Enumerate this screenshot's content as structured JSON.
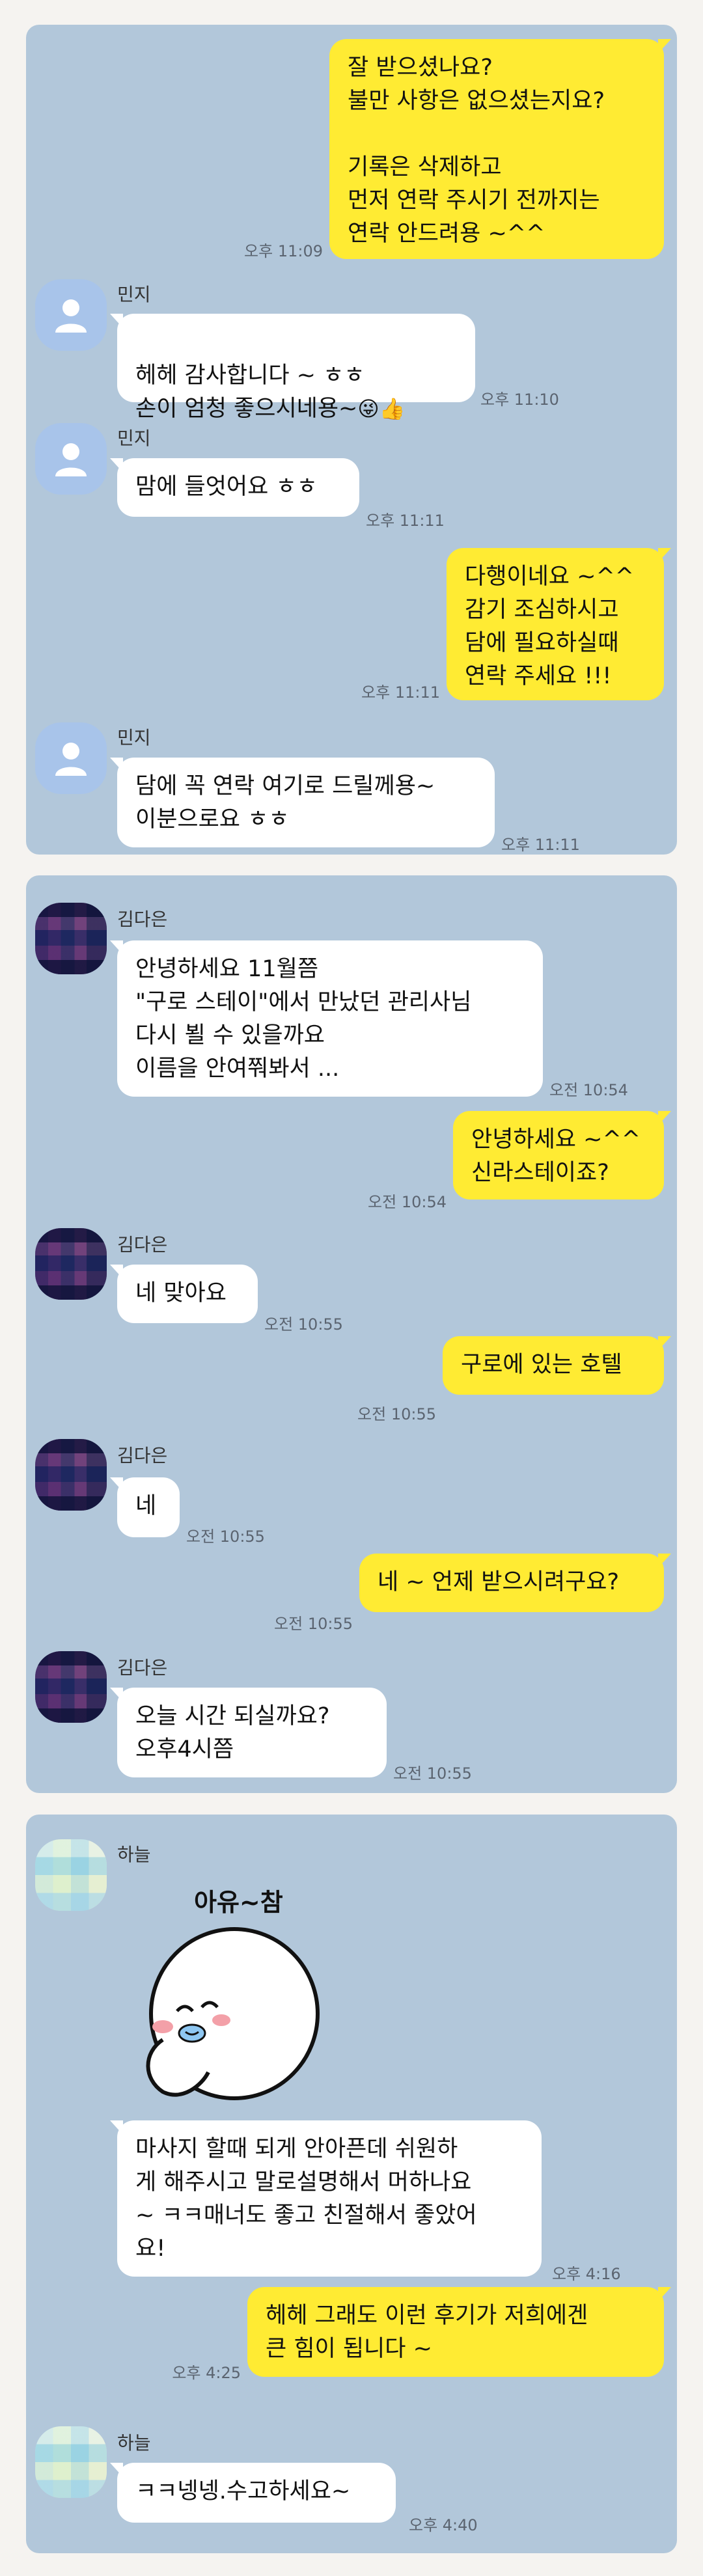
{
  "panel1": {
    "m1": {
      "text": "잘 받으셨나요?\n불만 사항은 없으셨는지요?\n\n기록은 삭제하고\n먼저 연락 주시기 전까지는\n연락 안드려용 ~^^",
      "time": "오후 11:09"
    },
    "m2": {
      "sender": "민지",
      "text": "헤헤 감사합니다 ~ ㅎㅎ\n손이 엄청 좋으시네용~",
      "emoji": "😜👍",
      "time": "오후 11:10"
    },
    "m3": {
      "sender": "민지",
      "text": "맘에 들엇어요 ㅎㅎ",
      "time": "오후 11:11"
    },
    "m4": {
      "text": "다행이네요 ~^^\n감기 조심하시고\n담에 필요하실때\n연락 주세요 !!!",
      "time": "오후 11:11"
    },
    "m5": {
      "sender": "민지",
      "text": "담에 꼭 연락 여기로 드릴께용~\n이분으로요 ㅎㅎ",
      "time": "오후 11:11"
    }
  },
  "panel2": {
    "m1": {
      "sender": "김다은",
      "text": "안녕하세요 11월쯤\n\"구로 스테이\"에서 만났던 관리사님\n다시 뵐 수 있을까요\n이름을 안여쭤봐서 ...",
      "time": "오전 10:54"
    },
    "m2": {
      "text": "안녕하세요 ~^^\n신라스테이죠?",
      "time": "오전 10:54"
    },
    "m3": {
      "sender": "김다은",
      "text": "네 맞아요",
      "time": "오전 10:55"
    },
    "m4": {
      "text": "구로에 있는 호텔",
      "time": "오전 10:55"
    },
    "m5": {
      "sender": "김다은",
      "text": "네",
      "time": "오전 10:55"
    },
    "m6": {
      "text": "네 ~ 언제 받으시려구요?",
      "time": "오전 10:55"
    },
    "m7": {
      "sender": "김다은",
      "text": "오늘  시간 되실까요?\n오후4시쯤",
      "time": "오전 10:55"
    }
  },
  "panel3": {
    "sender": "하늘",
    "sticker_text": "아유~참",
    "m1": {
      "text": "마사지 할때 되게 안아픈데 쉬원하\n게 해주시고 말로설명해서 머하나요\n~ ㅋㅋ매너도 좋고 친절해서 좋았어\n요!",
      "time": "오후 4:16"
    },
    "m2": {
      "text": "헤헤 그래도 이런 후기가 저희에겐\n큰 힘이 됩니다 ~",
      "time": "오후 4:25"
    },
    "m3": {
      "sender": "하늘",
      "text": "ㅋㅋ넹넹.수고하세요~",
      "time": "오후 4:40"
    }
  },
  "colors": {
    "panel_bg": "#b2c7da",
    "my_bubble": "#ffeb33",
    "their_bubble": "#ffffff",
    "page_bg": "#f5f3f0"
  },
  "icons": {
    "default_avatar": "person-silhouette-icon"
  }
}
